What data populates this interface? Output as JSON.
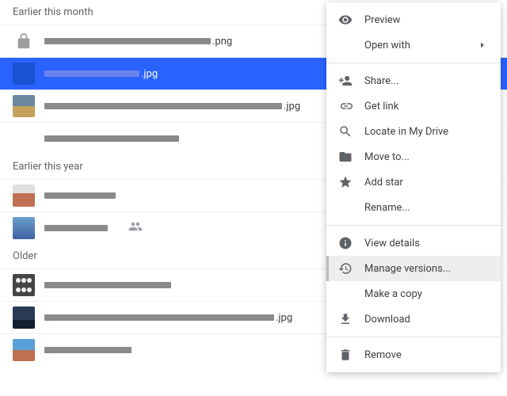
{
  "sections": {
    "earlier_month": "Earlier this month",
    "earlier_year": "Earlier this year",
    "older": "Older"
  },
  "files": {
    "f0_ext": ".png",
    "f1_ext": ".jpg",
    "f2_ext": ".jpg",
    "f3_ext": "",
    "f4_ext": "",
    "f5_ext": "",
    "f6_ext": "",
    "f7_ext": ".jpg",
    "f8_ext": ""
  },
  "menu": {
    "preview": "Preview",
    "open_with": "Open with",
    "share": "Share...",
    "get_link": "Get link",
    "locate": "Locate in My Drive",
    "move_to": "Move to...",
    "add_star": "Add star",
    "rename": "Rename...",
    "view_details": "View details",
    "manage_versions": "Manage versions...",
    "make_copy": "Make a copy",
    "download": "Download",
    "remove": "Remove"
  }
}
